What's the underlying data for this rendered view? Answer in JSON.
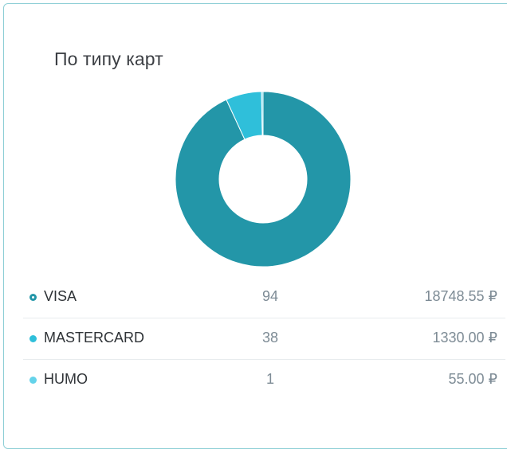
{
  "card": {
    "title": "По типу карт"
  },
  "chart_data": {
    "type": "pie",
    "donut": true,
    "title": "По типу карт",
    "categories": [
      "VISA",
      "MASTERCARD",
      "HUMO"
    ],
    "values": [
      18748.55,
      1330.0,
      55.0
    ],
    "counts": [
      94,
      38,
      1
    ],
    "colors": [
      "#2396a8",
      "#2fbfda",
      "#64d3ea"
    ],
    "legend_position": "bottom"
  },
  "legend": {
    "rows": [
      {
        "name": "VISA",
        "count": "94",
        "amount": "18748.55 ₽",
        "color": "#2396a8"
      },
      {
        "name": "MASTERCARD",
        "count": "38",
        "amount": "1330.00 ₽",
        "color": "#2fbfda"
      },
      {
        "name": "HUMO",
        "count": "1",
        "amount": "55.00 ₽",
        "color": "#64d3ea"
      }
    ]
  }
}
